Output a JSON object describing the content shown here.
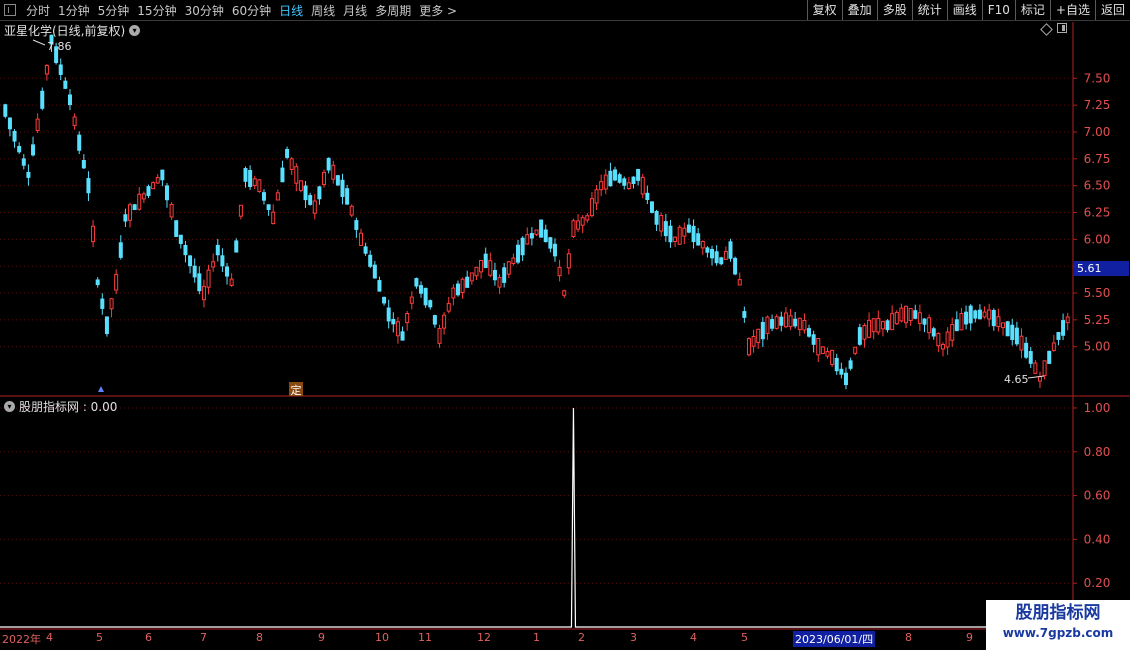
{
  "toolbar": {
    "periods": [
      "分时",
      "1分钟",
      "5分钟",
      "15分钟",
      "30分钟",
      "60分钟",
      "日线",
      "周线",
      "月线",
      "多周期",
      "更多 >"
    ],
    "active_period": "日线",
    "right_tools": [
      "复权",
      "叠加",
      "多股",
      "统计",
      "画线",
      "F10",
      "标记",
      "+自选",
      "返回"
    ]
  },
  "price_panel": {
    "title": "亚星化学(日线,前复权)",
    "current_price": "5.61",
    "high_label": "7.86",
    "low_label": "4.65",
    "marker_ding": "定",
    "y_ticks": [
      "7.50",
      "7.25",
      "7.00",
      "6.75",
      "6.50",
      "6.25",
      "6.00",
      "5.75",
      "5.50",
      "5.25",
      "5.00"
    ]
  },
  "indicator_panel": {
    "title": "股朋指标网 : 0.00",
    "y_ticks": [
      "1.00",
      "0.80",
      "0.60",
      "0.40",
      "0.20"
    ]
  },
  "time_axis": {
    "labels": [
      "2022年",
      "4",
      "5",
      "6",
      "7",
      "8",
      "9",
      "10",
      "11",
      "12",
      "1",
      "2",
      "3",
      "4",
      "5",
      "8",
      "9"
    ],
    "cursor_date": "2023/06/01/四"
  },
  "watermark": {
    "title": "股朋指标网",
    "url": "www.7gpzb.com"
  },
  "colors": {
    "up": "#ff3c3c",
    "down": "#5ae0ff",
    "axis": "#b02020",
    "grid": "#5a1010"
  },
  "chart_data": {
    "type": "candlestick",
    "y_range": [
      4.55,
      7.95
    ],
    "indicator_range": [
      0,
      1.05
    ],
    "indicator_spike_index": 123,
    "indicator_spike_value": 1.0,
    "anchors": [
      [
        0,
        7.2
      ],
      [
        5,
        6.6
      ],
      [
        8,
        7.3
      ],
      [
        10,
        7.86
      ],
      [
        14,
        7.3
      ],
      [
        18,
        6.5
      ],
      [
        20,
        5.6
      ],
      [
        22,
        5.2
      ],
      [
        24,
        5.6
      ],
      [
        26,
        6.2
      ],
      [
        30,
        6.4
      ],
      [
        34,
        6.6
      ],
      [
        37,
        6.1
      ],
      [
        40,
        5.8
      ],
      [
        43,
        5.5
      ],
      [
        46,
        5.9
      ],
      [
        49,
        5.6
      ],
      [
        52,
        6.6
      ],
      [
        55,
        6.5
      ],
      [
        58,
        6.2
      ],
      [
        61,
        6.8
      ],
      [
        64,
        6.5
      ],
      [
        67,
        6.3
      ],
      [
        70,
        6.7
      ],
      [
        74,
        6.4
      ],
      [
        77,
        6.0
      ],
      [
        80,
        5.7
      ],
      [
        83,
        5.3
      ],
      [
        86,
        5.1
      ],
      [
        89,
        5.6
      ],
      [
        92,
        5.4
      ],
      [
        94,
        5.1
      ],
      [
        97,
        5.5
      ],
      [
        100,
        5.6
      ],
      [
        104,
        5.8
      ],
      [
        107,
        5.6
      ],
      [
        110,
        5.8
      ],
      [
        113,
        6.0
      ],
      [
        116,
        6.1
      ],
      [
        119,
        5.9
      ],
      [
        121,
        5.5
      ],
      [
        123,
        6.1
      ],
      [
        126,
        6.2
      ],
      [
        129,
        6.5
      ],
      [
        132,
        6.6
      ],
      [
        135,
        6.5
      ],
      [
        137,
        6.6
      ],
      [
        141,
        6.2
      ],
      [
        145,
        6.0
      ],
      [
        148,
        6.1
      ],
      [
        152,
        5.9
      ],
      [
        155,
        5.8
      ],
      [
        157,
        5.9
      ],
      [
        159,
        5.6
      ],
      [
        161,
        5.0
      ],
      [
        165,
        5.2
      ],
      [
        169,
        5.25
      ],
      [
        173,
        5.2
      ],
      [
        176,
        5.0
      ],
      [
        179,
        4.9
      ],
      [
        182,
        4.7
      ],
      [
        185,
        5.1
      ],
      [
        188,
        5.2
      ],
      [
        191,
        5.2
      ],
      [
        194,
        5.3
      ],
      [
        197,
        5.3
      ],
      [
        200,
        5.2
      ],
      [
        203,
        5.0
      ],
      [
        206,
        5.2
      ],
      [
        209,
        5.3
      ],
      [
        213,
        5.3
      ],
      [
        216,
        5.2
      ],
      [
        219,
        5.1
      ],
      [
        222,
        4.9
      ],
      [
        224,
        4.7
      ],
      [
        226,
        4.9
      ],
      [
        228,
        5.1
      ],
      [
        230,
        5.25
      ]
    ],
    "candle_count": 231
  }
}
